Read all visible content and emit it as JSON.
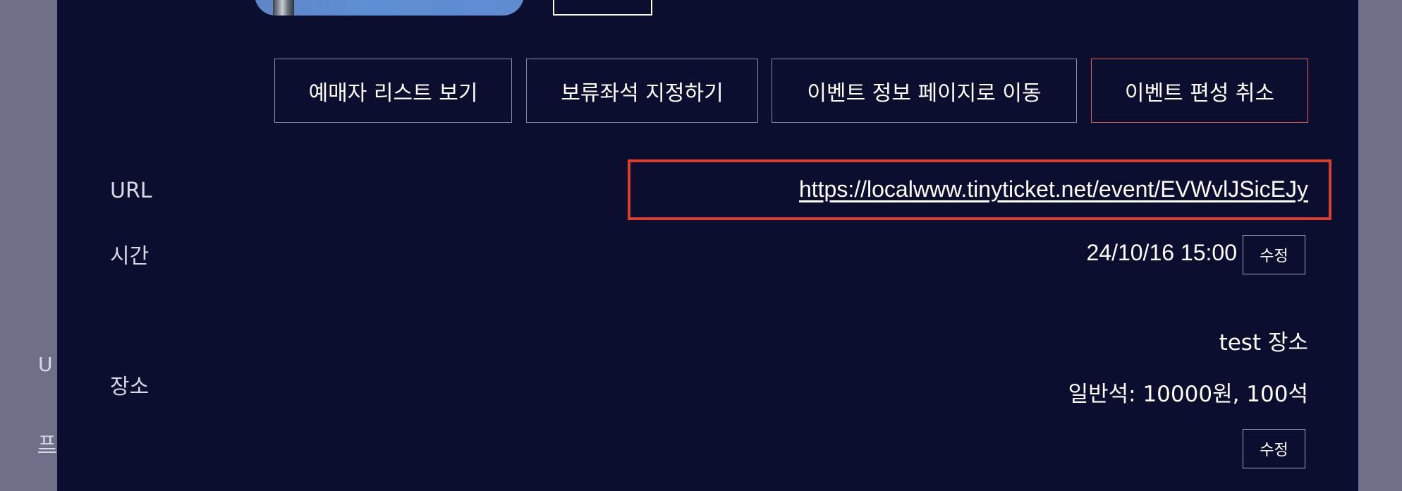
{
  "background": {
    "text_u": "U",
    "text_p": "프"
  },
  "modal": {
    "actions": {
      "buyer_list_label": "예매자 리스트 보기",
      "hold_seats_label": "보류좌석 지정하기",
      "event_page_label": "이벤트 정보 페이지로 이동",
      "cancel_event_label": "이벤트 편성 취소"
    },
    "url": {
      "label": "URL",
      "value": "https://localwww.tinyticket.net/event/EVWvlJSicEJy"
    },
    "time": {
      "label": "시간",
      "value": "24/10/16 15:00",
      "edit_label": "수정"
    },
    "place": {
      "label": "장소",
      "name": "test 장소",
      "seats": "일반석: 10000원, 100석",
      "edit_label": "수정"
    }
  },
  "colors": {
    "page_overlay": "#6f7087",
    "modal_background": "#0c0e2f",
    "button_border": "#8a8ca6",
    "danger_border": "#e2605a",
    "highlight_border": "#d9412e",
    "text": "#ffffff",
    "label_text": "#d8d9e4"
  },
  "icons": {
    "event_thumbnail": "event-thumbnail-image"
  }
}
